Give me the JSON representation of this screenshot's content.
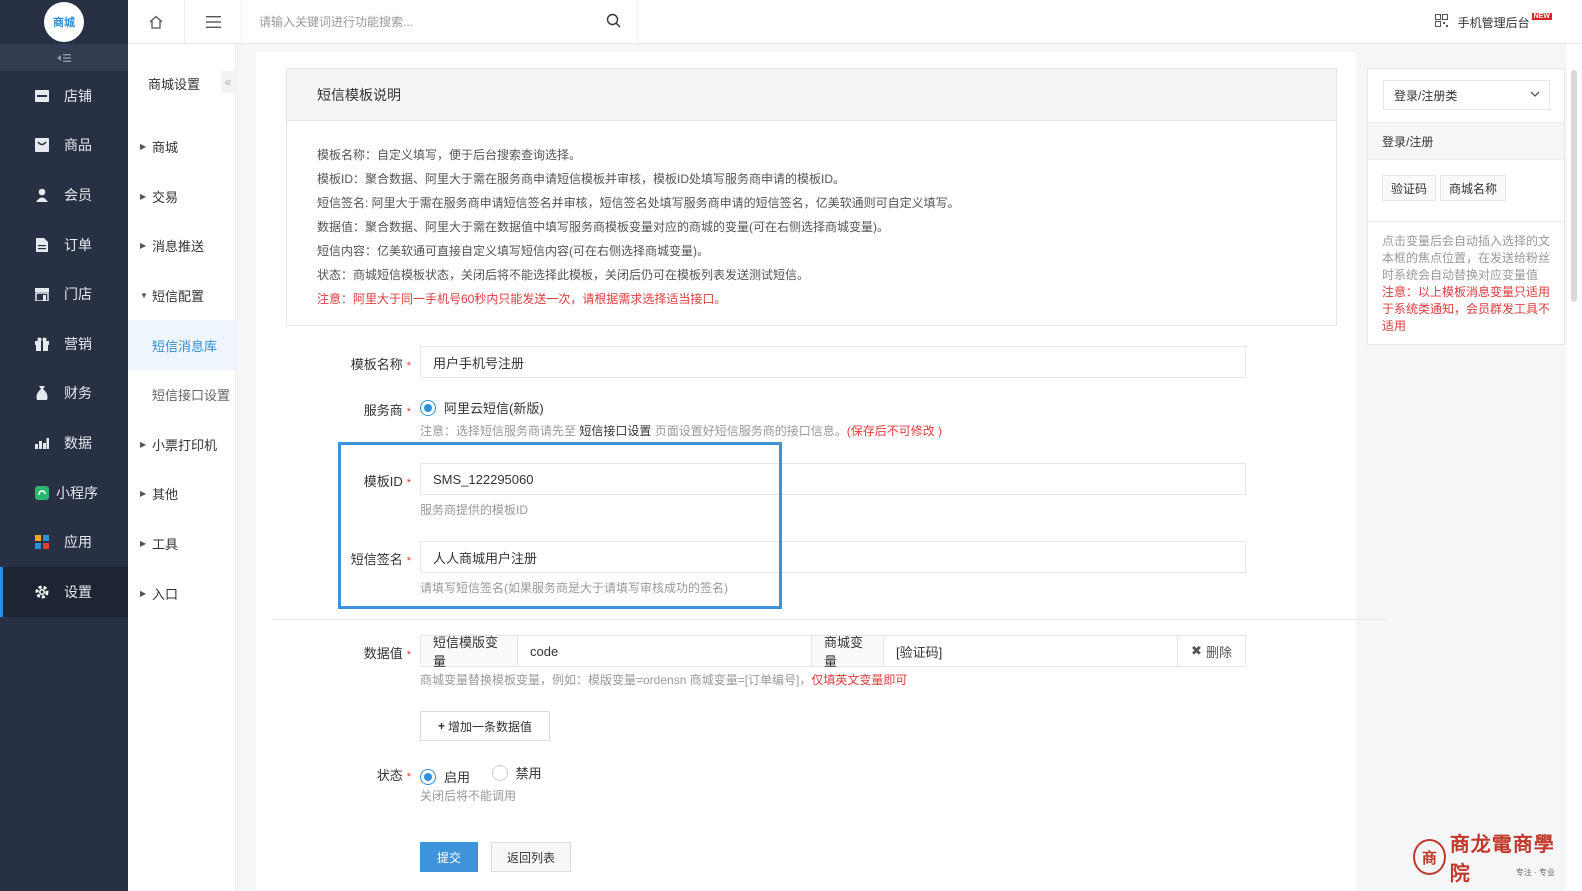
{
  "sidebar": {
    "logo_text": "商城",
    "items": [
      {
        "label": "店铺",
        "icon": "store-icon"
      },
      {
        "label": "商品",
        "icon": "goods-icon"
      },
      {
        "label": "会员",
        "icon": "user-icon"
      },
      {
        "label": "订单",
        "icon": "order-icon"
      },
      {
        "label": "门店",
        "icon": "shop-icon"
      },
      {
        "label": "营销",
        "icon": "gift-icon"
      },
      {
        "label": "财务",
        "icon": "money-bag-icon"
      },
      {
        "label": "数据",
        "icon": "bar-chart-icon"
      },
      {
        "label": "小程序",
        "icon": "miniprogram-icon"
      },
      {
        "label": "应用",
        "icon": "apps-icon"
      },
      {
        "label": "设置",
        "icon": "gear-icon"
      }
    ]
  },
  "submenu": {
    "title": "商城设置",
    "items": [
      "商城",
      "交易",
      "消息推送",
      "短信配置",
      "短信消息库",
      "短信接口设置",
      "小票打印机",
      "其他",
      "工具",
      "入口"
    ]
  },
  "topbar": {
    "search_placeholder": "请输入关键词进行功能搜索...",
    "mobile_admin": "手机管理后台",
    "new_badge": "NEW"
  },
  "panel": {
    "title": "短信模板说明",
    "lines": [
      "模板名称：自定义填写，便于后台搜索查询选择。",
      "模板ID：聚合数据、阿里大于需在服务商申请短信模板并审核，模板ID处填写服务商申请的模板ID。",
      "短信签名: 阿里大于需在服务商申请短信签名并审核，短信签名处填写服务商申请的短信签名，亿美软通则可自定义填写。",
      "数据值：聚合数据、阿里大于需在数据值中填写服务商模板变量对应的商城的变量(可在右侧选择商城变量)。",
      "短信内容：亿美软通可直接自定义填写短信内容(可在右侧选择商城变量)。",
      "状态：商城短信模板状态，关闭后将不能选择此模板，关闭后仍可在模板列表发送测试短信。"
    ],
    "warning": "注意：阿里大于同一手机号60秒内只能发送一次，请根据需求选择适当接口。"
  },
  "form": {
    "template_name_label": "模板名称",
    "template_name_value": "用户手机号注册",
    "provider_label": "服务商",
    "provider_option": "阿里云短信(新版)",
    "provider_hint_pre": "注意：选择短信服务商请先至",
    "provider_hint_link": "短信接口设置",
    "provider_hint_post": "页面设置好短信服务商的接口信息。",
    "provider_hint_red": "(保存后不可修改 )",
    "template_id_label": "模板ID",
    "template_id_value": "SMS_122295060",
    "template_id_hint": "服务商提供的模板ID",
    "signature_label": "短信签名",
    "signature_value": "人人商城用户注册",
    "signature_hint": "请填写短信签名(如果服务商是大于请填写审核成功的签名)",
    "data_label": "数据值",
    "data_var_label": "短信模版变量",
    "data_var_value": "code",
    "data_mall_label": "商城变量",
    "data_mall_value": "[验证码]",
    "data_delete": "删除",
    "data_hint": "商城变量替换模板变量，例如：模版变量=ordensn 商城变量=[订单编号]，",
    "data_hint_red": "仅填英文变量即可",
    "add_data_button": "增加一条数据值",
    "status_label": "状态",
    "status_on": "启用",
    "status_off": "禁用",
    "status_hint": "关闭后将不能调用",
    "submit_button": "提交",
    "back_button": "返回列表",
    "required_mark": "*"
  },
  "variables": {
    "select_value": "登录/注册类",
    "category": "登录/注册",
    "tags": [
      "验证码",
      "商城名称"
    ],
    "note": "点击变量后会自动插入选择的文本框的焦点位置，在发送给粉丝时系统会自动替换对应变量值",
    "note_red": "注意：以上模板消息变量只适用于系统类通知，会员群发工具不适用"
  },
  "watermark": {
    "text": "商龙電商學院",
    "sub": "专注 · 专业"
  },
  "colors": {
    "sidebar_bg": "#283143",
    "accent": "#2f8fd8",
    "highlight_border": "#3f93d9",
    "warning": "#e03c3c"
  }
}
